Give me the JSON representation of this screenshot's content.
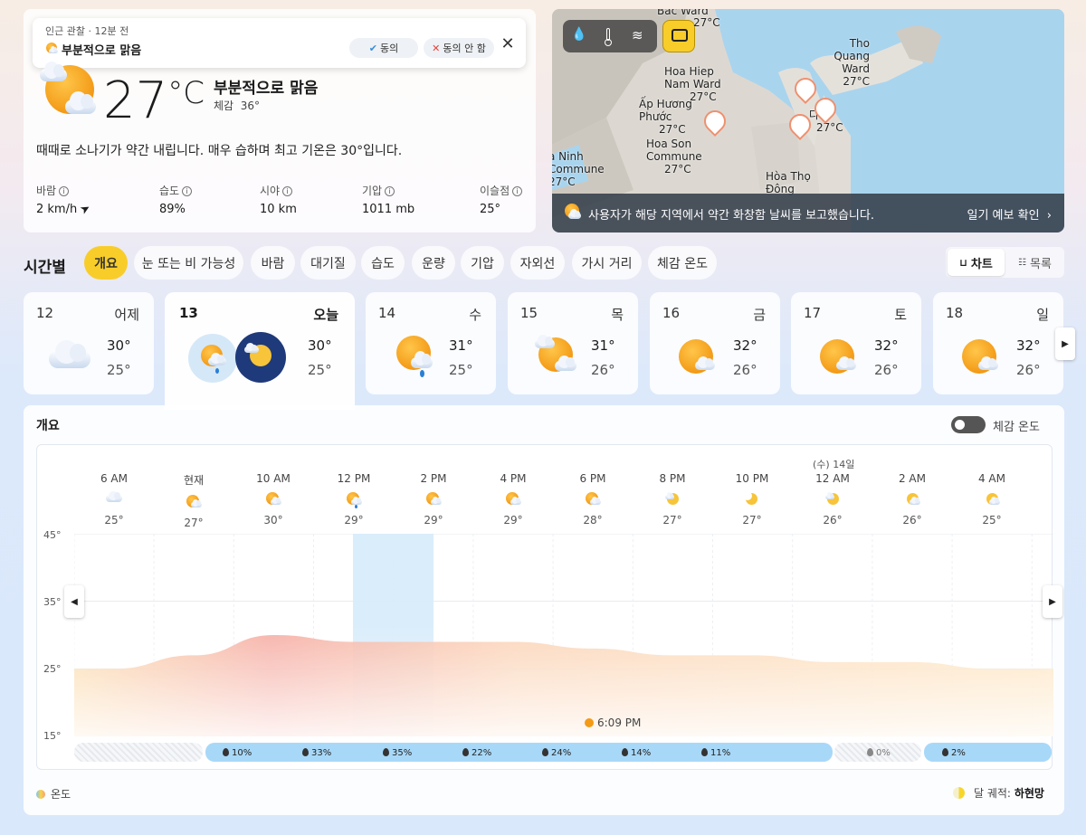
{
  "observation": {
    "meta": "인근 관찰 · 12분 전",
    "title": "부분적으로 맑음",
    "agree": "동의",
    "disagree": "동의 안 함"
  },
  "current": {
    "temp": "27",
    "unit": "°C",
    "condition": "부분적으로 맑음",
    "feels_label": "체감",
    "feels_value": "36°",
    "summary": "때때로 소나기가 약간 내립니다. 매우 습하며 최고 기온은 30°입니다.",
    "stats": [
      {
        "label": "바람",
        "value": "2 km/h"
      },
      {
        "label": "습도",
        "value": "89%"
      },
      {
        "label": "시야",
        "value": "10 km"
      },
      {
        "label": "기압",
        "value": "1011 mb"
      },
      {
        "label": "이슬점",
        "value": "25°"
      }
    ]
  },
  "map": {
    "places": [
      {
        "name": "Bac Ward",
        "temp": "27°C"
      },
      {
        "name": "Tho Quang Ward",
        "temp": "27°C"
      },
      {
        "name": "Hoa Hiep Nam Ward",
        "temp": "27°C"
      },
      {
        "name": "Ấp Hương Phước",
        "temp": "27°C"
      },
      {
        "name": "다낭",
        "temp": "27°C"
      },
      {
        "name": "Hoa Son Commune",
        "temp": "27°C"
      },
      {
        "name": "a Ninh Commune",
        "temp": "27°C"
      },
      {
        "name": "Hòa Thọ Đông",
        "temp": ""
      }
    ],
    "report": "사용자가 해당 지역에서 약간 화창함 날씨를 보고했습니다.",
    "report_link": "일기 예보 확인"
  },
  "hourly_section": {
    "title": "시간별",
    "tabs": [
      "개요",
      "눈 또는 비 가능성",
      "바람",
      "대기질",
      "습도",
      "운량",
      "기압",
      "자외선",
      "가시 거리",
      "체감 온도"
    ],
    "view_chart": "차트",
    "view_list": "목록"
  },
  "days": [
    {
      "date": "12",
      "weekday": "어제",
      "hi": "30°",
      "lo": "25°",
      "icon": "cloud-icon"
    },
    {
      "date": "13",
      "weekday": "오늘",
      "hi": "30°",
      "lo": "25°",
      "icon": "rain-sun-icon"
    },
    {
      "date": "14",
      "weekday": "수",
      "hi": "31°",
      "lo": "25°",
      "icon": "rain-sun-icon"
    },
    {
      "date": "15",
      "weekday": "목",
      "hi": "31°",
      "lo": "26°",
      "icon": "partly-cloudy-icon"
    },
    {
      "date": "16",
      "weekday": "금",
      "hi": "32°",
      "lo": "26°",
      "icon": "partly-sunny-icon"
    },
    {
      "date": "17",
      "weekday": "토",
      "hi": "32°",
      "lo": "26°",
      "icon": "partly-sunny-icon"
    },
    {
      "date": "18",
      "weekday": "일",
      "hi": "32°",
      "lo": "26°",
      "icon": "partly-sunny-icon"
    }
  ],
  "overview": {
    "title": "개요",
    "feels_toggle": "체감 온도",
    "next_day": "(수) 14일",
    "hours": [
      {
        "time": "6 AM",
        "temp": "25°",
        "icon": "cloud-icon"
      },
      {
        "time": "현재",
        "temp": "27°",
        "icon": "partly-sunny-icon"
      },
      {
        "time": "10 AM",
        "temp": "30°",
        "icon": "partly-sunny-icon"
      },
      {
        "time": "12 PM",
        "temp": "29°",
        "icon": "rain-sun-icon"
      },
      {
        "time": "2 PM",
        "temp": "29°",
        "icon": "partly-sunny-icon"
      },
      {
        "time": "4 PM",
        "temp": "29°",
        "icon": "partly-sunny-icon"
      },
      {
        "time": "6 PM",
        "temp": "28°",
        "icon": "partly-sunny-icon"
      },
      {
        "time": "8 PM",
        "temp": "27°",
        "icon": "moon-cloud-icon"
      },
      {
        "time": "10 PM",
        "temp": "27°",
        "icon": "moon-icon"
      },
      {
        "time": "12 AM",
        "temp": "26°",
        "icon": "moon-cloud-icon"
      },
      {
        "time": "2 AM",
        "temp": "26°",
        "icon": "moon-cloud-icon"
      },
      {
        "time": "4 AM",
        "temp": "25°",
        "icon": "moon-cloud-icon"
      }
    ],
    "sunset": "6:09 PM",
    "precip": [
      "10%",
      "33%",
      "35%",
      "22%",
      "24%",
      "14%",
      "11%",
      "0%",
      "2%"
    ],
    "legend_temp": "온도",
    "moon_label": "달 궤적:",
    "moon_value": "하현망"
  },
  "chart_data": {
    "type": "area",
    "title": "",
    "xlabel": "",
    "ylabel": "",
    "ylim": [
      15,
      45
    ],
    "yticks": [
      "45°",
      "35°",
      "25°",
      "15°"
    ],
    "x": [
      "6 AM",
      "현재",
      "10 AM",
      "12 PM",
      "2 PM",
      "4 PM",
      "6 PM",
      "8 PM",
      "10 PM",
      "12 AM",
      "2 AM",
      "4 AM"
    ],
    "series": [
      {
        "values": [
          25,
          27,
          30,
          29,
          29,
          29,
          28,
          27,
          27,
          26,
          26,
          25
        ]
      }
    ],
    "precipitation": [
      "10%",
      "33%",
      "35%",
      "22%",
      "24%",
      "14%",
      "11%",
      "0%",
      "2%"
    ]
  },
  "colors": {
    "accent": "#f8cd2a",
    "rain_band": "#a8d8f8",
    "temp_warm": "#f5a9a0",
    "temp_mild": "#fbd8b8",
    "report_bg": "#3b4652"
  }
}
